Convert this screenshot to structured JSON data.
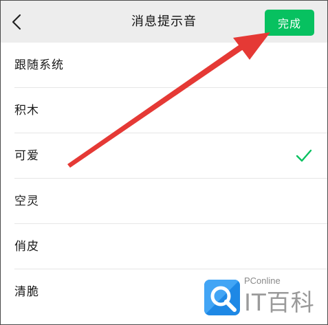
{
  "header": {
    "back_icon": "chevron-left-icon",
    "title": "消息提示音",
    "done_label": "完成"
  },
  "sounds": [
    {
      "label": "跟随系统",
      "selected": false
    },
    {
      "label": "积木",
      "selected": false
    },
    {
      "label": "可爱",
      "selected": true
    },
    {
      "label": "空灵",
      "selected": false
    },
    {
      "label": "俏皮",
      "selected": false
    },
    {
      "label": "清脆",
      "selected": false
    }
  ],
  "check_icon": "checkmark-icon",
  "watermark": {
    "small_text": "PConline",
    "big_text": "IT百科"
  },
  "colors": {
    "header_bg": "#ededed",
    "accent_green": "#07c160",
    "check_green": "#07c160",
    "annotation_arrow": "#e53935",
    "watermark_blue": "#1e88e5"
  }
}
